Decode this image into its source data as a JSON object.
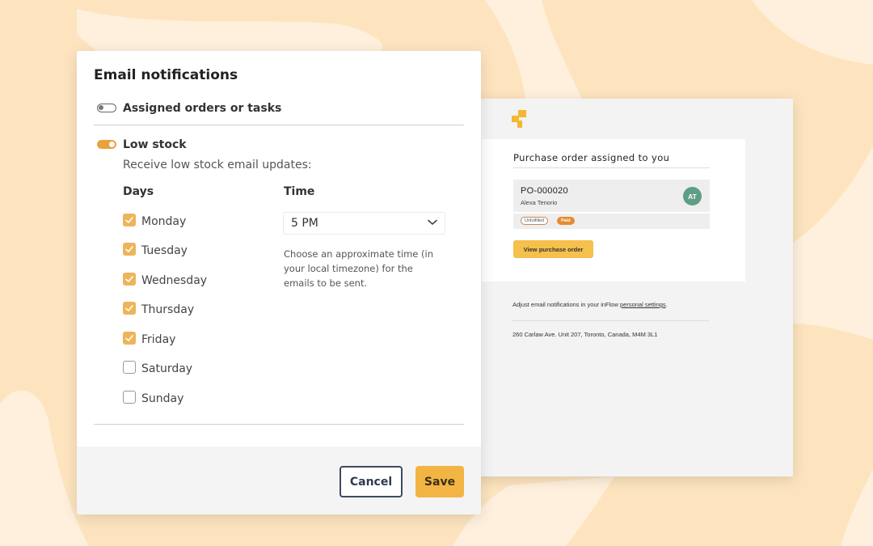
{
  "colors": {
    "background": "#fde4bf",
    "background_light": "#fef0dc",
    "accent": "#f2b544",
    "toggle_on": "#e8a33e",
    "checkbox_on": "#eeb45a",
    "avatar": "#5f9e86",
    "cancel_border": "#3e4a5e"
  },
  "modal": {
    "title": "Email notifications",
    "options": [
      {
        "label": "Assigned orders or tasks",
        "enabled": false,
        "icon": "toggle-off"
      },
      {
        "label": "Low stock",
        "enabled": true,
        "icon": "toggle-on"
      }
    ],
    "low_stock_subtitle": "Receive low stock email updates:",
    "days_header": "Days",
    "time_header": "Time",
    "days": [
      {
        "label": "Monday",
        "checked": true
      },
      {
        "label": "Tuesday",
        "checked": true
      },
      {
        "label": "Wednesday",
        "checked": true
      },
      {
        "label": "Thursday",
        "checked": true
      },
      {
        "label": "Friday",
        "checked": true
      },
      {
        "label": "Saturday",
        "checked": false
      },
      {
        "label": "Sunday",
        "checked": false
      }
    ],
    "time_value": "5 PM",
    "time_icon": "chevron-down-icon",
    "time_help": "Choose an approximate time (in your local timezone) for the emails to be sent.",
    "cancel_label": "Cancel",
    "save_label": "Save"
  },
  "email": {
    "logo_icon": "inflow-logo-icon",
    "title": "Purchase order assigned to you",
    "po_number": "PO-000020",
    "po_person": "Alexa Tenorio",
    "avatar_initials": "AT",
    "tag_unfulfilled": "Unfulfilled",
    "tag_paid": "Paid",
    "view_button": "View purchase order",
    "footer_prefix": "Adjust email notifications in your inFlow ",
    "footer_link": "personal settings",
    "footer_suffix": ".",
    "address": "260 Carlaw Ave. Unit 207, Toronto, Canada, M4M 3L1"
  }
}
